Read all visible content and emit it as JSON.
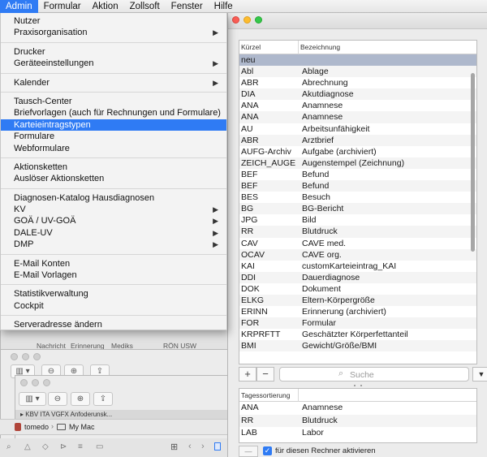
{
  "menubar": {
    "items": [
      "Admin",
      "Formular",
      "Aktion",
      "Zollsoft",
      "Fenster",
      "Hilfe"
    ]
  },
  "admin_menu": {
    "groups": [
      [
        {
          "label": "Nutzer"
        },
        {
          "label": "Praxisorganisation",
          "submenu": true
        }
      ],
      [
        {
          "label": "Drucker"
        },
        {
          "label": "Geräteeinstellungen",
          "submenu": true
        }
      ],
      [
        {
          "label": "Kalender",
          "submenu": true
        }
      ],
      [
        {
          "label": "Tausch-Center"
        },
        {
          "label": "Briefvorlagen (auch für Rechnungen und Formulare)"
        },
        {
          "label": "Karteieintragstypen",
          "highlighted": true
        },
        {
          "label": "Formulare"
        },
        {
          "label": "Webformulare"
        }
      ],
      [
        {
          "label": "Aktionsketten"
        },
        {
          "label": "Auslöser Aktionsketten"
        }
      ],
      [
        {
          "label": "Diagnosen-Katalog Hausdiagnosen"
        },
        {
          "label": "KV",
          "submenu": true
        },
        {
          "label": "GOÄ / UV-GOÄ",
          "submenu": true
        },
        {
          "label": "DALE-UV",
          "submenu": true
        },
        {
          "label": "DMP",
          "submenu": true
        }
      ],
      [
        {
          "label": "E-Mail Konten"
        },
        {
          "label": "E-Mail Vorlagen"
        }
      ],
      [
        {
          "label": "Statistikverwaltung"
        },
        {
          "label": "Cockpit"
        }
      ],
      [
        {
          "label": "Serveradresse ändern"
        }
      ]
    ]
  },
  "background": {
    "toolbar_labels": [
      "Nachricht",
      "Erinnerung",
      "Mediks",
      "RÖN USW"
    ],
    "file_item": "KBV ITA VGFX Anfoderunsk...",
    "path_items": [
      "tomedo",
      "My Mac"
    ]
  },
  "types_table": {
    "headers": [
      "Kürzel",
      "Bezeichnung"
    ],
    "rows": [
      [
        "neu",
        ""
      ],
      [
        "Abl",
        "Ablage"
      ],
      [
        "ABR",
        "Abrechnung"
      ],
      [
        "DIA",
        "Akutdiagnose"
      ],
      [
        "ANA",
        "Anamnese"
      ],
      [
        "ANA",
        "Anamnese"
      ],
      [
        "AU",
        "Arbeitsunfähigkeit"
      ],
      [
        "ABR",
        "Arztbrief"
      ],
      [
        "AUFG-Archiv",
        "Aufgabe (archiviert)"
      ],
      [
        "ZEICH_AUGE",
        "Augenstempel (Zeichnung)"
      ],
      [
        "BEF",
        "Befund"
      ],
      [
        "BEF",
        "Befund"
      ],
      [
        "BES",
        "Besuch"
      ],
      [
        "BG",
        "BG-Bericht"
      ],
      [
        "JPG",
        "Bild"
      ],
      [
        "RR",
        "Blutdruck"
      ],
      [
        "CAV",
        "CAVE med."
      ],
      [
        "OCAV",
        "CAVE org."
      ],
      [
        "KAI",
        "customKarteieintrag_KAI"
      ],
      [
        "DDI",
        "Dauerdiagnose"
      ],
      [
        "DOK",
        "Dokument"
      ],
      [
        "ELKG",
        "Eltern-Körpergröße"
      ],
      [
        "ERINN",
        "Erinnerung (archiviert)"
      ],
      [
        "FOR",
        "Formular"
      ],
      [
        "KRPRFTT",
        "Geschätzter Körperfettanteil"
      ],
      [
        "BMI",
        "Gewicht/Größe/BMI"
      ]
    ]
  },
  "toolbar": {
    "add_label": "+",
    "remove_label": "−",
    "search_placeholder": "Suche",
    "menu_label": "▼"
  },
  "sort_table": {
    "headers": [
      "Tagessortierung",
      ""
    ],
    "rows": [
      [
        "ANA",
        "Anamnese"
      ],
      [
        "RR",
        "Blutdruck"
      ],
      [
        "LAB",
        "Labor"
      ]
    ]
  },
  "footer": {
    "minus_label": "—",
    "checkbox_checked": true,
    "checkbox_label": "für diesen Rechner aktivieren"
  },
  "colors": {
    "accent": "#2f7bf4",
    "selected_row": "#aeb8cc"
  }
}
